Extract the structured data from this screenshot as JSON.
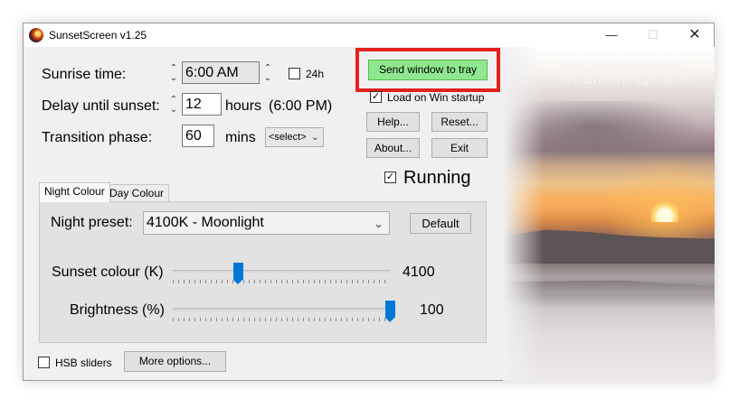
{
  "window": {
    "title": "SunsetScreen v1.25",
    "controls": {
      "minimize": "—",
      "maximize": "☐",
      "close": "✕"
    }
  },
  "settings": {
    "sunrise_label": "Sunrise time:",
    "sunrise_value": "6:00 AM",
    "h24_label": "24h",
    "h24_checked": false,
    "delay_label": "Delay until sunset:",
    "delay_value": "12",
    "delay_unit": "hours",
    "delay_computed": "(6:00 PM)",
    "transition_label": "Transition phase:",
    "transition_value": "60",
    "transition_unit": "mins",
    "transition_select": "<select>"
  },
  "actions": {
    "send_to_tray": "Send window to tray",
    "load_on_startup": "Load on Win startup",
    "load_on_startup_checked": true,
    "help": "Help...",
    "reset": "Reset...",
    "about": "About...",
    "exit": "Exit",
    "running": "Running",
    "running_checked": true
  },
  "tabs": [
    {
      "label": "Night Colour",
      "active": true
    },
    {
      "label": "Day Colour",
      "active": false
    }
  ],
  "night": {
    "preset_label": "Night preset:",
    "preset_value": "4100K - Moonlight",
    "default_button": "Default",
    "sunset_colour_label": "Sunset colour (K)",
    "sunset_colour_value": "4100",
    "sunset_colour_fraction": 0.3,
    "brightness_label": "Brightness (%)",
    "brightness_value": "100",
    "brightness_fraction": 1.0
  },
  "bottom": {
    "hsb_label": "HSB sliders",
    "hsb_checked": false,
    "more_options": "More options..."
  },
  "preview": {
    "time_text": "Time: 2017-05-22 17:57:38",
    "status_text": "Transitioning to Night: 46.07%"
  },
  "icons": {
    "spin": "⌃⌄",
    "dropdown": "chevron-down-icon",
    "check": "✓"
  },
  "colors": {
    "tray_button": "#8fe88f",
    "highlight": "#e3211d",
    "slider_accent": "#0078d7"
  }
}
